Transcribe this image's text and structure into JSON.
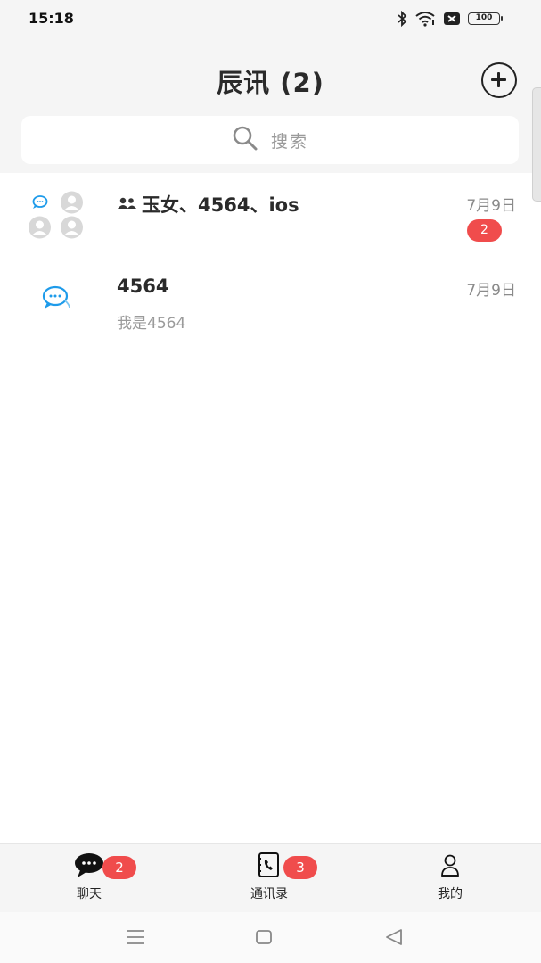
{
  "status_bar": {
    "time": "15:18",
    "battery": "100",
    "icons": [
      "bluetooth-icon",
      "wifi-icon",
      "notification-icon",
      "battery-icon"
    ]
  },
  "header": {
    "title": "辰讯 (2)",
    "add_icon": "plus-circle-icon"
  },
  "search": {
    "placeholder": "搜索",
    "icon": "search-icon"
  },
  "conversations": [
    {
      "name": "玉女、4564、ios",
      "is_group": true,
      "time": "7月9日",
      "preview": "",
      "unread": "2"
    },
    {
      "name": "4564",
      "is_group": false,
      "time": "7月9日",
      "preview": "我是4564",
      "unread": ""
    }
  ],
  "tab_bar": {
    "tabs": [
      {
        "label": "聊天",
        "icon": "chat-bubble-icon",
        "badge": "2"
      },
      {
        "label": "通讯录",
        "icon": "contacts-book-icon",
        "badge": "3"
      },
      {
        "label": "我的",
        "icon": "person-icon",
        "badge": ""
      }
    ]
  },
  "colors": {
    "badge": "#f04c4c",
    "chat_icon_blue": "#1e9bea",
    "background": "#f5f5f5"
  }
}
